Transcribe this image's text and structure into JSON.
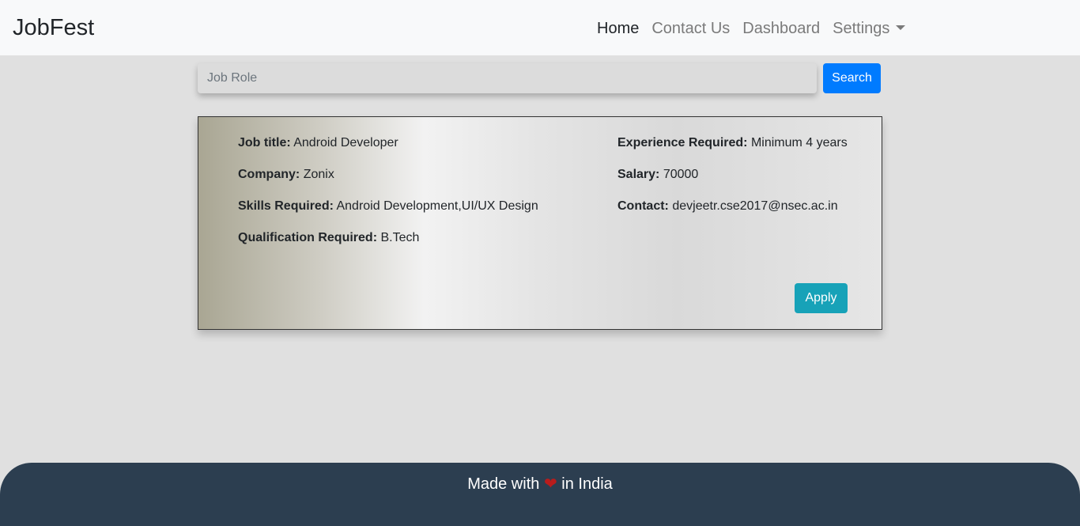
{
  "navbar": {
    "brand": "JobFest",
    "links": [
      {
        "label": "Home"
      },
      {
        "label": "Contact Us"
      },
      {
        "label": "Dashboard"
      },
      {
        "label": "Settings"
      }
    ]
  },
  "search": {
    "placeholder": "Job Role",
    "value": "",
    "button_label": "Search"
  },
  "job": {
    "title_label": "Job title:",
    "title": "Android Developer",
    "company_label": "Company:",
    "company": "Zonix",
    "skills_label": "Skills Required:",
    "skills": "Android Development,UI/UX Design",
    "qualification_label": "Qualification Required:",
    "qualification": "B.Tech",
    "experience_label": "Experience Required:",
    "experience": "Minimum 4 years",
    "salary_label": "Salary:",
    "salary": "70000",
    "contact_label": "Contact:",
    "contact": "devjeetr.cse2017@nsec.ac.in",
    "apply_label": "Apply"
  },
  "footer": {
    "prefix": "Made with",
    "heart_icon": "heart-icon",
    "suffix": "in India"
  },
  "colors": {
    "primary": "#007bff",
    "info": "#17a2b8",
    "footer_bg": "#2c3e50",
    "heart": "#b91c1c"
  }
}
